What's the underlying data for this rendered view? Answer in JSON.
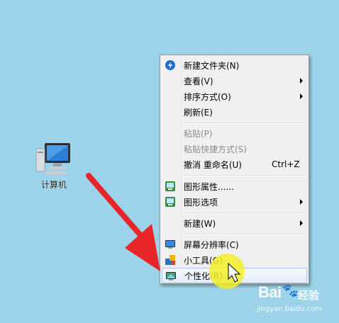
{
  "desktop": {
    "icon_label": "计算机",
    "icon_name": "computer-icon"
  },
  "context_menu": {
    "items": [
      {
        "label": "新建文件夹(N)",
        "icon": "new-folder-icon",
        "disabled": false,
        "submenu": false
      },
      {
        "label": "查看(V)",
        "disabled": false,
        "submenu": true
      },
      {
        "label": "排序方式(O)",
        "disabled": false,
        "submenu": true
      },
      {
        "label": "刷新(E)",
        "disabled": false,
        "submenu": false
      },
      {
        "label": "粘贴(P)",
        "disabled": true,
        "submenu": false
      },
      {
        "label": "粘贴快捷方式(S)",
        "disabled": true,
        "submenu": false
      },
      {
        "label": "撤消 重命名(U)",
        "shortcut": "Ctrl+Z",
        "disabled": false,
        "submenu": false
      },
      {
        "label": "图形属性......",
        "icon": "graphics-properties-icon",
        "disabled": false,
        "submenu": false
      },
      {
        "label": "图形选项",
        "icon": "graphics-options-icon",
        "disabled": false,
        "submenu": true
      },
      {
        "label": "新建(W)",
        "disabled": false,
        "submenu": true
      },
      {
        "label": "屏幕分辨率(C)",
        "icon": "screen-resolution-icon",
        "disabled": false,
        "submenu": false
      },
      {
        "label": "小工具(G)",
        "icon": "gadgets-icon",
        "disabled": false,
        "submenu": false
      },
      {
        "label": "个性化(R)",
        "icon": "personalize-icon",
        "disabled": false,
        "submenu": false,
        "highlighted": true
      }
    ]
  },
  "annotation": {
    "arrow_color": "#e8262a",
    "highlight_color": "#f7f23a"
  },
  "watermark": {
    "brand": "Bai",
    "brand_cn": "经验",
    "url": "jingyan.baidu.com"
  }
}
